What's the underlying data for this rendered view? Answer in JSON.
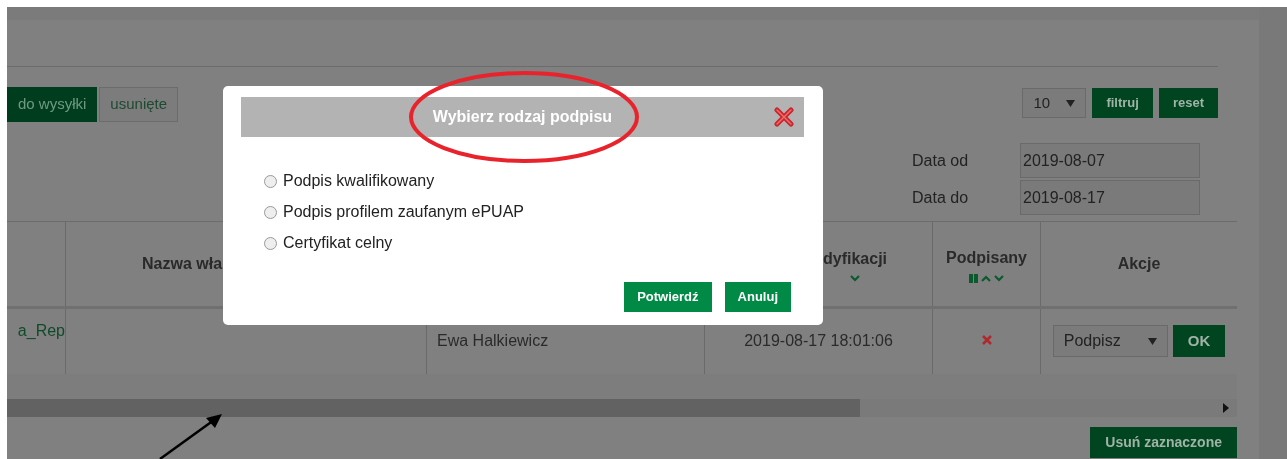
{
  "tabs": [
    {
      "label": "do wysyłki",
      "selected": true
    },
    {
      "label": "usunięte",
      "selected": false
    }
  ],
  "filters": {
    "page_size": "10",
    "buttons": [
      "filtruj",
      "reset"
    ],
    "dates": [
      {
        "label": "Data od",
        "value": "2019-08-07"
      },
      {
        "label": "Data do",
        "value": "2019-08-17"
      }
    ]
  },
  "table": {
    "columns": [
      {
        "label": "Nazwa wła",
        "kind": "text"
      },
      {
        "label": "dyfikacji",
        "kind": "sort_down"
      },
      {
        "label": "Podpisany",
        "kind": "filter_sort"
      },
      {
        "label": "Akcje",
        "kind": "text"
      }
    ],
    "rows": [
      {
        "name": "a_Rep",
        "owner": "Ewa Halkiewicz",
        "modified": "2019-08-17 18:01:06",
        "signed": false,
        "action": "Podpisz",
        "confirm": "OK"
      }
    ]
  },
  "delete_button": "Usuń zaznaczone",
  "modal": {
    "title": "Wybierz rodzaj podpisu",
    "options": [
      {
        "label": "Podpis kwalifikowany",
        "selected": false
      },
      {
        "label": "Podpis profilem zaufanym ePUAP",
        "selected": false
      },
      {
        "label": "Certyfikat celny",
        "selected": false
      }
    ],
    "buttons": [
      "Potwierdź",
      "Anuluj"
    ]
  }
}
